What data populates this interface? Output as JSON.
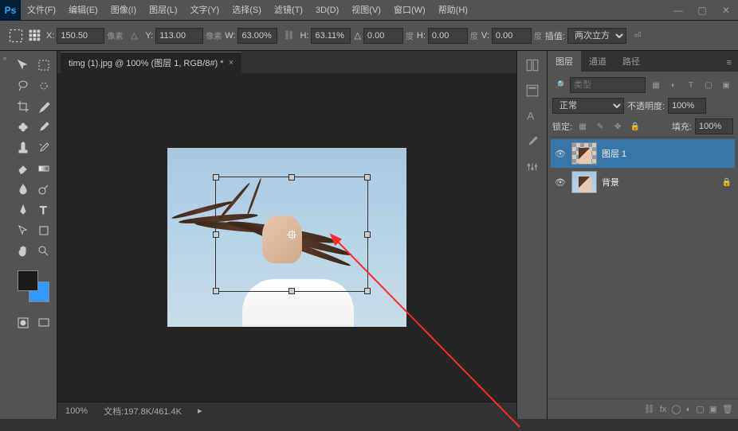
{
  "app": {
    "logo": "Ps"
  },
  "menu": {
    "file": "文件(F)",
    "edit": "编辑(E)",
    "image": "图像(I)",
    "layer": "图层(L)",
    "type": "文字(Y)",
    "select": "选择(S)",
    "filter": "滤镜(T)",
    "3d": "3D(D)",
    "view": "视图(V)",
    "window": "窗口(W)",
    "help": "帮助(H)"
  },
  "win": {
    "min": "—",
    "max": "▢",
    "close": "✕"
  },
  "options": {
    "x_label": "X:",
    "x_value": "150.50",
    "x_unit": "像素",
    "y_label": "Y:",
    "y_value": "113.00",
    "y_unit": "像素",
    "w_label": "W:",
    "w_value": "63.00%",
    "h_label": "H:",
    "h_value": "63.11%",
    "angle_label": "△",
    "angle_value": "0.00",
    "angle_unit": "度",
    "hskew_label": "H:",
    "hskew_value": "0.00",
    "hskew_unit": "度",
    "vskew_label": "V:",
    "vskew_value": "0.00",
    "vskew_unit": "度",
    "interp_label": "插值:",
    "interp_value": "两次立方"
  },
  "document": {
    "tab_title": "timg (1).jpg @ 100% (图层 1, RGB/8#) *",
    "tab_close": "×"
  },
  "status": {
    "zoom": "100%",
    "doc_label": "文档:",
    "doc_info": "197.8K/461.4K"
  },
  "panels": {
    "tabs": {
      "layers": "图层",
      "channels": "通道",
      "paths": "路径"
    },
    "filter_placeholder": "类型",
    "filter_icons": {
      "search": "🔎",
      "pixel": "▦",
      "adj": "◐",
      "type": "T",
      "shape": "▢",
      "smart": "▣"
    },
    "blend_mode": "正常",
    "opacity_label": "不透明度:",
    "opacity_value": "100%",
    "lock_label": "锁定:",
    "fill_label": "填充:",
    "fill_value": "100%",
    "layers_list": [
      {
        "name": "图层 1",
        "visible": true,
        "active": true,
        "checker": true
      },
      {
        "name": "背景",
        "visible": true,
        "active": false,
        "locked": true
      }
    ],
    "footer_icons": {
      "link": "⛓",
      "fx": "fx",
      "mask": "◯",
      "adj": "◐",
      "group": "▢",
      "new": "▣",
      "trash": "🗑"
    }
  },
  "window_controls": {
    "min": "—",
    "max": "▢",
    "close": "✕"
  }
}
